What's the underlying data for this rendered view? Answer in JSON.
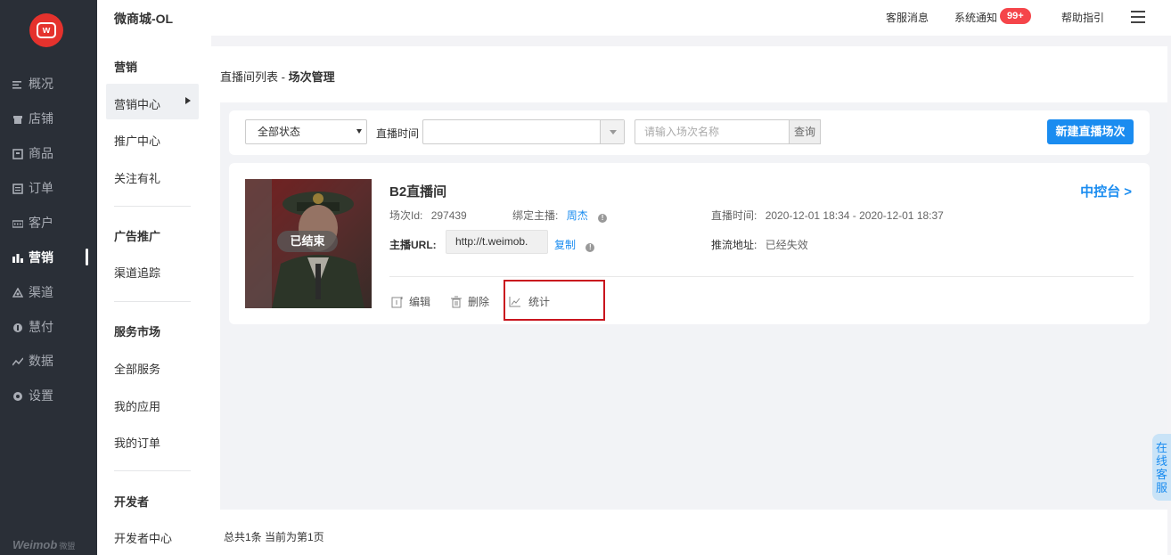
{
  "nav": {
    "items": [
      {
        "label": "概况",
        "icon": "overview-icon"
      },
      {
        "label": "店铺",
        "icon": "store-icon"
      },
      {
        "label": "商品",
        "icon": "goods-icon"
      },
      {
        "label": "订单",
        "icon": "order-icon"
      },
      {
        "label": "客户",
        "icon": "customer-icon"
      },
      {
        "label": "营销",
        "icon": "marketing-icon",
        "active": true
      },
      {
        "label": "渠道",
        "icon": "channel-icon"
      },
      {
        "label": "慧付",
        "icon": "pay-icon"
      },
      {
        "label": "数据",
        "icon": "data-icon"
      },
      {
        "label": "设置",
        "icon": "settings-icon"
      }
    ],
    "brand": "Weimob",
    "brand_cn": "微盟"
  },
  "subnav": {
    "shop_title": "微商城-OL",
    "groups": [
      {
        "title": "营销",
        "items": [
          "营销中心",
          "推广中心",
          "关注有礼"
        ]
      },
      {
        "title": "广告推广",
        "items": [
          "渠道追踪"
        ]
      },
      {
        "title": "服务市场",
        "items": [
          "全部服务",
          "我的应用",
          "我的订单"
        ]
      },
      {
        "title": "开发者",
        "items": [
          "开发者中心"
        ]
      }
    ]
  },
  "topbar": {
    "service_msg": "客服消息",
    "sys_notice": "系统通知",
    "notice_badge": "99+",
    "help": "帮助指引"
  },
  "breadcrumb": {
    "parent": "直播间列表 - ",
    "current": "场次管理"
  },
  "filter": {
    "status_selected": "全部状态",
    "time_label": "直播时间",
    "search_placeholder": "请输入场次名称",
    "query_label": "查询",
    "new_button": "新建直播场次"
  },
  "session": {
    "status_badge": "已结束",
    "name": "B2直播间",
    "id_label": "场次Id:",
    "id_value": "297439",
    "anchor_label": "绑定主播:",
    "anchor_value": "周杰",
    "time_label": "直播时间:",
    "time_value": "2020-12-01 18:34 - 2020-12-01 18:37",
    "url_label": "主播URL:",
    "url_value": "http://t.weimob.",
    "copy_label": "复制",
    "push_label": "推流地址:",
    "push_value": "已经失效",
    "console_label": "中控台 >",
    "actions": {
      "edit": "编辑",
      "delete": "删除",
      "stats": "统计"
    }
  },
  "pager": {
    "text": "总共1条 当前为第1页"
  },
  "online_service": [
    "在",
    "线",
    "客",
    "服"
  ],
  "colors": {
    "accent": "#1a8cf0",
    "nav_bg": "#2a2f37",
    "badge": "#f5454a",
    "highlight": "#c9151e",
    "logo": "#e5322d"
  }
}
